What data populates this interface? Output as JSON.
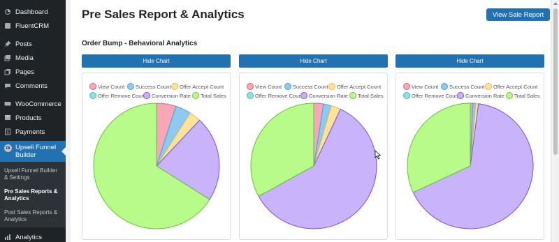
{
  "sidebar": {
    "items_top": [
      {
        "label": "Dashboard",
        "icon": "dashboard-icon"
      },
      {
        "label": "FluentCRM",
        "icon": "fluentcrm-icon"
      }
    ],
    "items_mid": [
      {
        "label": "Posts",
        "icon": "pin-icon"
      },
      {
        "label": "Media",
        "icon": "media-icon"
      },
      {
        "label": "Pages",
        "icon": "pages-icon"
      },
      {
        "label": "Comments",
        "icon": "comments-icon"
      }
    ],
    "items_shop": [
      {
        "label": "WooCommerce",
        "icon": "woocommerce-icon"
      },
      {
        "label": "Products",
        "icon": "products-icon"
      },
      {
        "label": "Payments",
        "icon": "payments-icon"
      }
    ],
    "active": {
      "label_line1": "Upsell Funnel",
      "label_line2": "Builder",
      "avatar_text": "F8"
    },
    "submenu": [
      {
        "line1": "Upsell Funnel Builder",
        "line2": "& Settings"
      },
      {
        "line1": "Pre Sales Reports &",
        "line2": "Analytics"
      },
      {
        "line1": "Post Sales Reports &",
        "line2": "Analytics"
      }
    ],
    "bottom": {
      "label": "Analytics",
      "icon": "analytics-icon"
    }
  },
  "header": {
    "title": "Pre Sales Report & Analytics",
    "view_button": "View Sale Report"
  },
  "section": {
    "title": "Order Bump - Behavioral Analytics"
  },
  "hide_chart_label": "Hide Chart",
  "colors": {
    "view": "#f7a8b8",
    "success": "#8ec9f2",
    "accept": "#fbe39a",
    "remove": "#8fe0e0",
    "conversion": "#c9b3fb",
    "sales": "#b8fb8a",
    "accent": "#2271b1",
    "sidebar": "#1d2327"
  },
  "chart_data": [
    {
      "type": "pie",
      "legend": [
        "View Count",
        "Success Count",
        "Offer Accept Count",
        "Offer Remove Count",
        "Conversion Rate",
        "Total Sales"
      ],
      "values": [
        5,
        4,
        3,
        0,
        22,
        66
      ]
    },
    {
      "type": "pie",
      "legend": [
        "View Count",
        "Success Count",
        "Offer Accept Count",
        "Offer Remove Count",
        "Conversion Rate",
        "Total Sales"
      ],
      "values": [
        2.5,
        2,
        2.5,
        0,
        60,
        33
      ]
    },
    {
      "type": "pie",
      "legend": [
        "View Count",
        "Success Count",
        "Offer Accept Count",
        "Offer Remove Count",
        "Conversion Rate",
        "Total Sales"
      ],
      "values": [
        0.6,
        0.8,
        0.7,
        0,
        66,
        31.9
      ]
    }
  ]
}
